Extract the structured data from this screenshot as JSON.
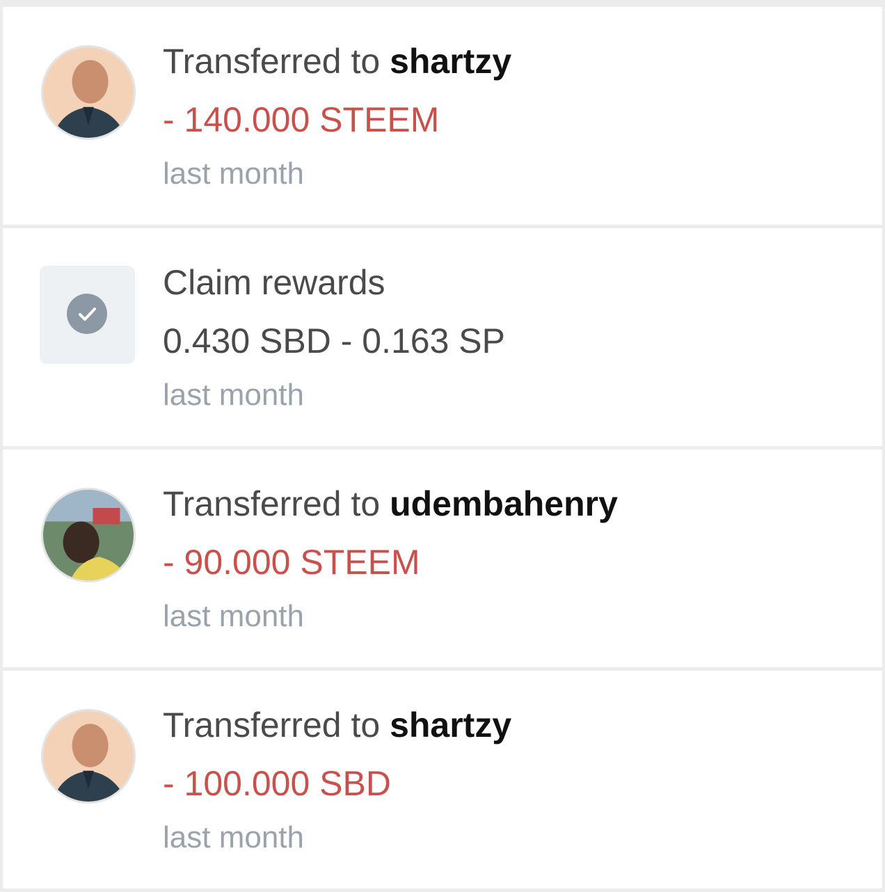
{
  "transactions": [
    {
      "type": "transfer",
      "prefix": "Transferred to ",
      "user": "shartzy",
      "amount": "- 140.000 STEEM",
      "time": "last month",
      "avatar_icon": "user-avatar-icon"
    },
    {
      "type": "claim",
      "title": "Claim rewards",
      "amount": "0.430 SBD - 0.163 SP",
      "time": "last month",
      "icon": "checkmark-icon"
    },
    {
      "type": "transfer",
      "prefix": "Transferred to ",
      "user": "udembahenry",
      "amount": "- 90.000 STEEM",
      "time": "last month",
      "avatar_icon": "user-avatar-icon"
    },
    {
      "type": "transfer",
      "prefix": "Transferred to ",
      "user": "shartzy",
      "amount": "- 100.000 SBD",
      "time": "last month",
      "avatar_icon": "user-avatar-icon"
    }
  ],
  "colors": {
    "negative_amount": "#c8514c",
    "username": "#111111",
    "timestamp": "#9aa3ab",
    "row_background": "#ffffff",
    "divider": "#ececec"
  }
}
